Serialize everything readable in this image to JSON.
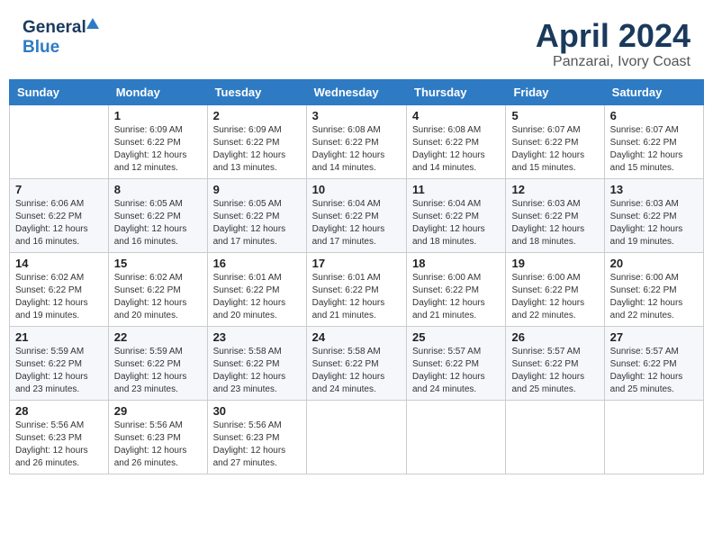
{
  "header": {
    "logo_general": "General",
    "logo_blue": "Blue",
    "month": "April 2024",
    "location": "Panzarai, Ivory Coast"
  },
  "columns": [
    "Sunday",
    "Monday",
    "Tuesday",
    "Wednesday",
    "Thursday",
    "Friday",
    "Saturday"
  ],
  "weeks": [
    [
      {
        "day": "",
        "sunrise": "",
        "sunset": "",
        "daylight": ""
      },
      {
        "day": "1",
        "sunrise": "Sunrise: 6:09 AM",
        "sunset": "Sunset: 6:22 PM",
        "daylight": "Daylight: 12 hours and 12 minutes."
      },
      {
        "day": "2",
        "sunrise": "Sunrise: 6:09 AM",
        "sunset": "Sunset: 6:22 PM",
        "daylight": "Daylight: 12 hours and 13 minutes."
      },
      {
        "day": "3",
        "sunrise": "Sunrise: 6:08 AM",
        "sunset": "Sunset: 6:22 PM",
        "daylight": "Daylight: 12 hours and 14 minutes."
      },
      {
        "day": "4",
        "sunrise": "Sunrise: 6:08 AM",
        "sunset": "Sunset: 6:22 PM",
        "daylight": "Daylight: 12 hours and 14 minutes."
      },
      {
        "day": "5",
        "sunrise": "Sunrise: 6:07 AM",
        "sunset": "Sunset: 6:22 PM",
        "daylight": "Daylight: 12 hours and 15 minutes."
      },
      {
        "day": "6",
        "sunrise": "Sunrise: 6:07 AM",
        "sunset": "Sunset: 6:22 PM",
        "daylight": "Daylight: 12 hours and 15 minutes."
      }
    ],
    [
      {
        "day": "7",
        "sunrise": "Sunrise: 6:06 AM",
        "sunset": "Sunset: 6:22 PM",
        "daylight": "Daylight: 12 hours and 16 minutes."
      },
      {
        "day": "8",
        "sunrise": "Sunrise: 6:05 AM",
        "sunset": "Sunset: 6:22 PM",
        "daylight": "Daylight: 12 hours and 16 minutes."
      },
      {
        "day": "9",
        "sunrise": "Sunrise: 6:05 AM",
        "sunset": "Sunset: 6:22 PM",
        "daylight": "Daylight: 12 hours and 17 minutes."
      },
      {
        "day": "10",
        "sunrise": "Sunrise: 6:04 AM",
        "sunset": "Sunset: 6:22 PM",
        "daylight": "Daylight: 12 hours and 17 minutes."
      },
      {
        "day": "11",
        "sunrise": "Sunrise: 6:04 AM",
        "sunset": "Sunset: 6:22 PM",
        "daylight": "Daylight: 12 hours and 18 minutes."
      },
      {
        "day": "12",
        "sunrise": "Sunrise: 6:03 AM",
        "sunset": "Sunset: 6:22 PM",
        "daylight": "Daylight: 12 hours and 18 minutes."
      },
      {
        "day": "13",
        "sunrise": "Sunrise: 6:03 AM",
        "sunset": "Sunset: 6:22 PM",
        "daylight": "Daylight: 12 hours and 19 minutes."
      }
    ],
    [
      {
        "day": "14",
        "sunrise": "Sunrise: 6:02 AM",
        "sunset": "Sunset: 6:22 PM",
        "daylight": "Daylight: 12 hours and 19 minutes."
      },
      {
        "day": "15",
        "sunrise": "Sunrise: 6:02 AM",
        "sunset": "Sunset: 6:22 PM",
        "daylight": "Daylight: 12 hours and 20 minutes."
      },
      {
        "day": "16",
        "sunrise": "Sunrise: 6:01 AM",
        "sunset": "Sunset: 6:22 PM",
        "daylight": "Daylight: 12 hours and 20 minutes."
      },
      {
        "day": "17",
        "sunrise": "Sunrise: 6:01 AM",
        "sunset": "Sunset: 6:22 PM",
        "daylight": "Daylight: 12 hours and 21 minutes."
      },
      {
        "day": "18",
        "sunrise": "Sunrise: 6:00 AM",
        "sunset": "Sunset: 6:22 PM",
        "daylight": "Daylight: 12 hours and 21 minutes."
      },
      {
        "day": "19",
        "sunrise": "Sunrise: 6:00 AM",
        "sunset": "Sunset: 6:22 PM",
        "daylight": "Daylight: 12 hours and 22 minutes."
      },
      {
        "day": "20",
        "sunrise": "Sunrise: 6:00 AM",
        "sunset": "Sunset: 6:22 PM",
        "daylight": "Daylight: 12 hours and 22 minutes."
      }
    ],
    [
      {
        "day": "21",
        "sunrise": "Sunrise: 5:59 AM",
        "sunset": "Sunset: 6:22 PM",
        "daylight": "Daylight: 12 hours and 23 minutes."
      },
      {
        "day": "22",
        "sunrise": "Sunrise: 5:59 AM",
        "sunset": "Sunset: 6:22 PM",
        "daylight": "Daylight: 12 hours and 23 minutes."
      },
      {
        "day": "23",
        "sunrise": "Sunrise: 5:58 AM",
        "sunset": "Sunset: 6:22 PM",
        "daylight": "Daylight: 12 hours and 23 minutes."
      },
      {
        "day": "24",
        "sunrise": "Sunrise: 5:58 AM",
        "sunset": "Sunset: 6:22 PM",
        "daylight": "Daylight: 12 hours and 24 minutes."
      },
      {
        "day": "25",
        "sunrise": "Sunrise: 5:57 AM",
        "sunset": "Sunset: 6:22 PM",
        "daylight": "Daylight: 12 hours and 24 minutes."
      },
      {
        "day": "26",
        "sunrise": "Sunrise: 5:57 AM",
        "sunset": "Sunset: 6:22 PM",
        "daylight": "Daylight: 12 hours and 25 minutes."
      },
      {
        "day": "27",
        "sunrise": "Sunrise: 5:57 AM",
        "sunset": "Sunset: 6:22 PM",
        "daylight": "Daylight: 12 hours and 25 minutes."
      }
    ],
    [
      {
        "day": "28",
        "sunrise": "Sunrise: 5:56 AM",
        "sunset": "Sunset: 6:23 PM",
        "daylight": "Daylight: 12 hours and 26 minutes."
      },
      {
        "day": "29",
        "sunrise": "Sunrise: 5:56 AM",
        "sunset": "Sunset: 6:23 PM",
        "daylight": "Daylight: 12 hours and 26 minutes."
      },
      {
        "day": "30",
        "sunrise": "Sunrise: 5:56 AM",
        "sunset": "Sunset: 6:23 PM",
        "daylight": "Daylight: 12 hours and 27 minutes."
      },
      {
        "day": "",
        "sunrise": "",
        "sunset": "",
        "daylight": ""
      },
      {
        "day": "",
        "sunrise": "",
        "sunset": "",
        "daylight": ""
      },
      {
        "day": "",
        "sunrise": "",
        "sunset": "",
        "daylight": ""
      },
      {
        "day": "",
        "sunrise": "",
        "sunset": "",
        "daylight": ""
      }
    ]
  ]
}
